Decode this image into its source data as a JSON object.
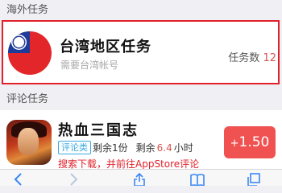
{
  "sections": {
    "overseas": "海外任务",
    "review": "评论任务"
  },
  "taiwan_task": {
    "title": "台湾地区任务",
    "subtitle": "需要台湾帐号",
    "count_label": "任务数",
    "count_value": "12"
  },
  "game_task": {
    "title": "热血三国志",
    "tag": "评论类",
    "remaining_prefix": "剩余1份",
    "time_prefix": "剩余",
    "time_value": "6.4",
    "time_suffix": "小时",
    "notice": "搜索下载，并前往AppStore评论",
    "reward_plus": "+",
    "reward_amount": "1.50元"
  },
  "colors": {
    "highlight_border": "#e0212a",
    "reward_bg": "#f05252",
    "tag_blue": "#39a9e0",
    "page_bg": "#efeff4"
  },
  "icons": [
    "taiwan-flag-icon",
    "game-app-icon",
    "back-icon",
    "forward-icon",
    "share-icon",
    "bookmarks-icon",
    "tabs-icon"
  ]
}
